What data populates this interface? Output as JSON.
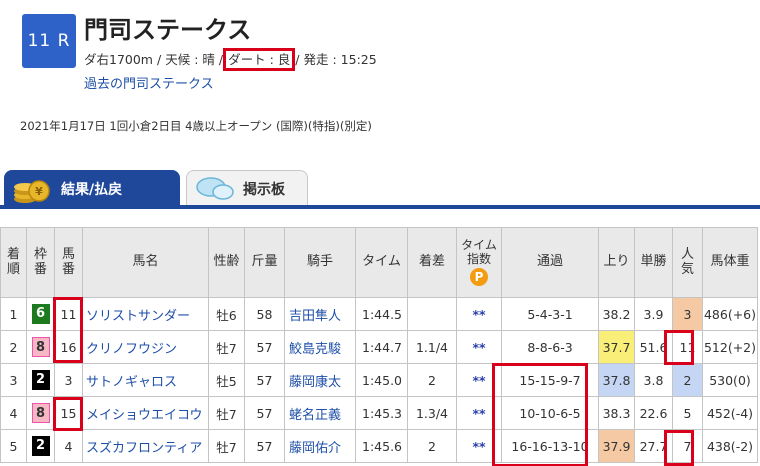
{
  "race": {
    "number": "11 R",
    "title": "門司ステークス",
    "course": "ダ右1700m",
    "weather": "天候 : 晴",
    "track": "ダート : 良",
    "start": "発走 : 15:25",
    "past_link": "過去の門司ステークス",
    "date_line": "2021年1月17日 1回小倉2日目 4歳以上オープン (国際)(特指)(別定)"
  },
  "tabs": [
    {
      "label": "結果/払戻",
      "active": true
    },
    {
      "label": "掲示板",
      "active": false
    }
  ],
  "table": {
    "headers": {
      "rank": [
        "着",
        "順"
      ],
      "waku": [
        "枠",
        "番"
      ],
      "umaban": [
        "馬",
        "番"
      ],
      "horse": "馬名",
      "sexage": "性齢",
      "weight": "斤量",
      "jockey": "騎手",
      "time": "タイム",
      "margin": "着差",
      "index": [
        "タイム",
        "指数"
      ],
      "index_badge": "P",
      "passing": "通過",
      "last3f": "上り",
      "odds": "単勝",
      "pop": [
        "人",
        "気"
      ],
      "body": "馬体重"
    },
    "rows": [
      {
        "rank": "1",
        "waku": "6",
        "umaban": "11",
        "horse": "ソリストサンダー",
        "sexage": "牡6",
        "weight": "58",
        "jockey": "吉田隼人",
        "time": "1:44.5",
        "margin": "",
        "index": "**",
        "passing": "5-4-3-1",
        "last3f": "38.2",
        "odds": "3.9",
        "pop": "3",
        "body": "486(+6)"
      },
      {
        "rank": "2",
        "waku": "8",
        "umaban": "16",
        "horse": "クリノフウジン",
        "sexage": "牡7",
        "weight": "57",
        "jockey": "鮫島克駿",
        "time": "1:44.7",
        "margin": "1.1/4",
        "index": "**",
        "passing": "8-8-6-3",
        "last3f": "37.7",
        "odds": "51.6",
        "pop": "11",
        "body": "512(+2)"
      },
      {
        "rank": "3",
        "waku": "2",
        "umaban": "3",
        "horse": "サトノギャロス",
        "sexage": "牡5",
        "weight": "57",
        "jockey": "藤岡康太",
        "time": "1:45.0",
        "margin": "2",
        "index": "**",
        "passing": "15-15-9-7",
        "last3f": "37.8",
        "odds": "3.8",
        "pop": "2",
        "body": "530(0)"
      },
      {
        "rank": "4",
        "waku": "8",
        "umaban": "15",
        "horse": "メイショウエイコウ",
        "sexage": "牡7",
        "weight": "57",
        "jockey": "蛯名正義",
        "time": "1:45.3",
        "margin": "1.3/4",
        "index": "**",
        "passing": "10-10-6-5",
        "last3f": "38.3",
        "odds": "22.6",
        "pop": "5",
        "body": "452(-4)"
      },
      {
        "rank": "5",
        "waku": "2",
        "umaban": "4",
        "horse": "スズカフロンティア",
        "sexage": "牡7",
        "weight": "57",
        "jockey": "藤岡佑介",
        "time": "1:45.6",
        "margin": "2",
        "index": "**",
        "passing": "16-16-13-10",
        "last3f": "37.9",
        "odds": "27.7",
        "pop": "7",
        "body": "438(-2)"
      }
    ]
  },
  "colors": {
    "brand_blue": "#20489a",
    "badge_blue": "#2f62c8",
    "link": "#1e4fa8",
    "highlight_red": "#d9001b"
  }
}
